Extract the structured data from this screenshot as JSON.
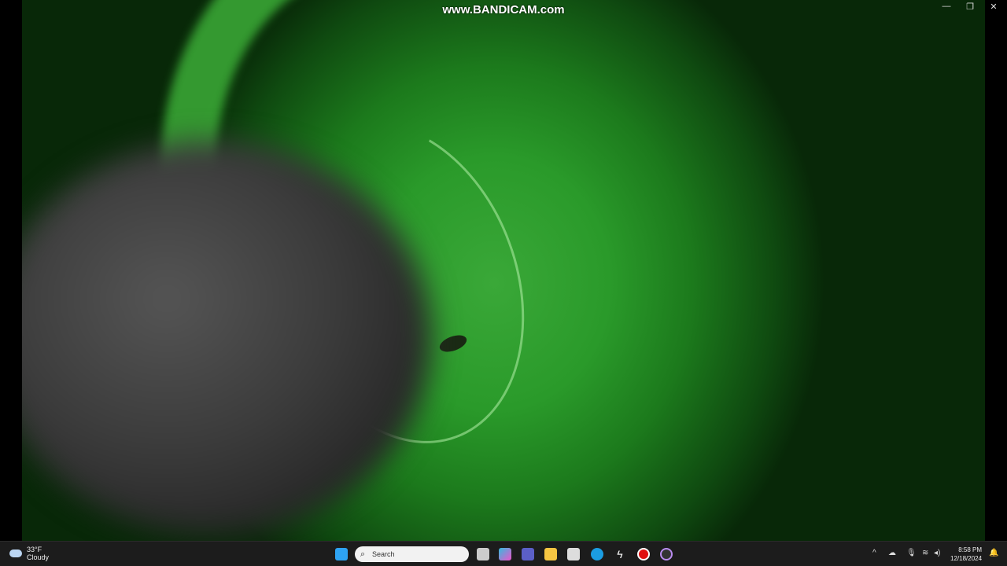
{
  "watermark": "www.BANDICAM.com",
  "window_controls": {
    "minimize": "—",
    "restore": "❐",
    "close": "✕"
  },
  "weather": {
    "temp": "33°F",
    "condition": "Cloudy"
  },
  "search": {
    "placeholder": "Search"
  },
  "clock": {
    "time": "8:58 PM",
    "date": "12/18/2024"
  }
}
